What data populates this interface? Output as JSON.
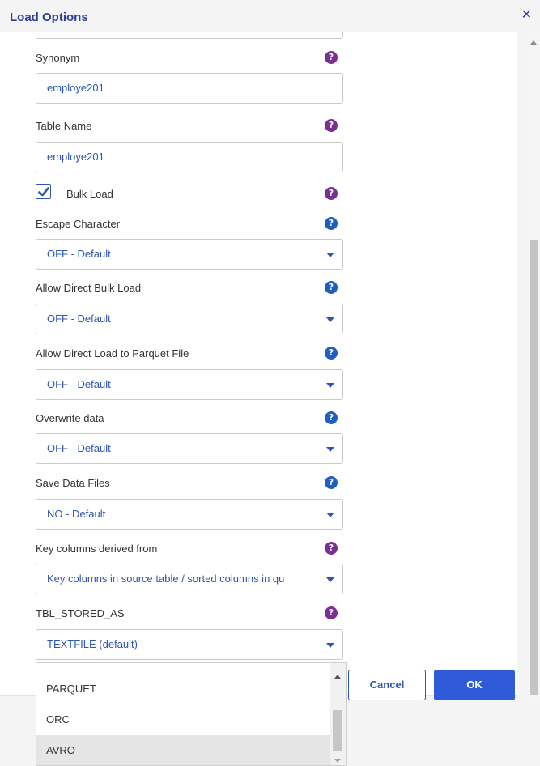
{
  "dialog": {
    "title": "Load Options",
    "close_glyph": "✕"
  },
  "fields": {
    "synonym": {
      "label": "Synonym",
      "value": "employe201"
    },
    "table_name": {
      "label": "Table Name",
      "value": "employe201"
    },
    "bulk_load": {
      "label": "Bulk Load",
      "checked": true
    },
    "escape_character": {
      "label": "Escape Character",
      "value": "OFF - Default"
    },
    "allow_direct_bulk_load": {
      "label": "Allow Direct Bulk Load",
      "value": "OFF - Default"
    },
    "allow_direct_load_parquet": {
      "label": "Allow Direct Load to Parquet File",
      "value": "OFF - Default"
    },
    "overwrite_data": {
      "label": "Overwrite data",
      "value": "OFF - Default"
    },
    "save_data_files": {
      "label": "Save Data Files",
      "value": "NO - Default"
    },
    "key_columns_derived_from": {
      "label": "Key columns derived from",
      "value": "Key columns in source table / sorted columns in qu"
    },
    "tbl_stored_as": {
      "label": "TBL_STORED_AS",
      "value": "TEXTFILE (default)"
    }
  },
  "help_glyph": "?",
  "dropdown_options": [
    "PARQUET",
    "ORC",
    "AVRO"
  ],
  "dropdown_hovered": "AVRO",
  "buttons": {
    "cancel": "Cancel",
    "ok": "OK"
  },
  "colors": {
    "accent": "#2f5ad8",
    "value_text": "#2d55b4",
    "help_purple": "#7b2f92",
    "help_blue": "#1f5fbf"
  }
}
